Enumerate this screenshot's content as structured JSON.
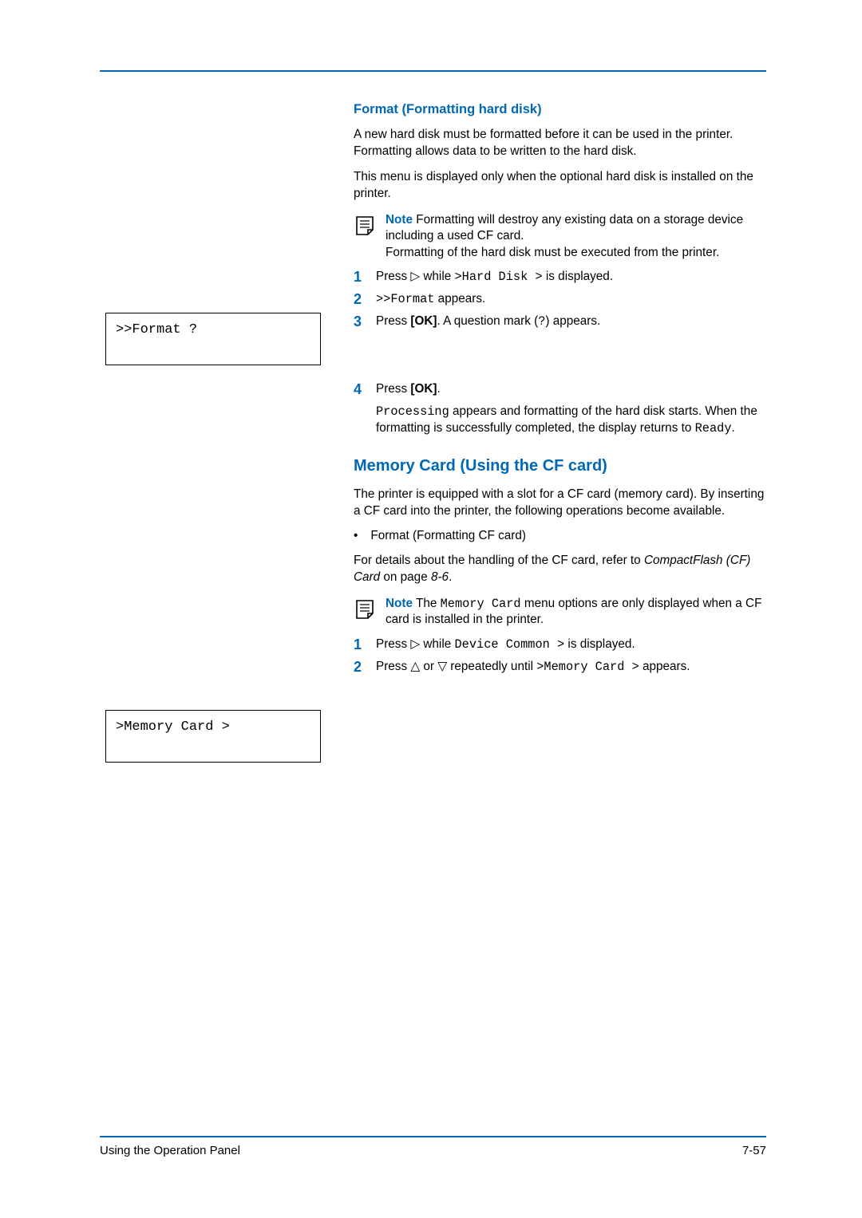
{
  "section1": {
    "heading": "Format (Formatting hard disk)",
    "p1": "A new hard disk must be formatted before it can be used in the printer. Formatting allows data to be written to the hard disk.",
    "p2": "This menu is displayed only when the optional hard disk is installed on the printer.",
    "note_label": "Note",
    "note_l1": "  Formatting will destroy any existing data on a storage device including a used CF card.",
    "note_l2": "Formatting of the hard disk must be executed from the printer.",
    "step1_a": "Press ",
    "step1_b": " while ",
    "step1_c": ">Hard Disk >",
    "step1_d": " is displayed.",
    "step2_a": ">>Format",
    "step2_b": " appears.",
    "step3_a": "Press ",
    "step3_b": "[OK]",
    "step3_c": ". A question mark (",
    "step3_d": "?",
    "step3_e": ") appears.",
    "step4_a": "Press ",
    "step4_b": "[OK]",
    "step4_c": ".",
    "step4_body_a": "Processing",
    "step4_body_b": " appears and formatting of the hard disk starts. When the formatting is successfully completed, the display returns to ",
    "step4_body_c": "Ready",
    "step4_body_d": "."
  },
  "display1": ">>Format ?",
  "section2": {
    "heading": "Memory Card (Using the CF card)",
    "p1": "The printer is equipped with a slot for a CF card (memory card). By inserting a CF card into the printer, the following operations become available.",
    "bullet1": "Format (Formatting CF card)",
    "p2_a": "For details about the handling of the CF card, refer to ",
    "p2_b": "CompactFlash (CF) Card",
    "p2_c": " on page ",
    "p2_d": "8-6",
    "p2_e": ".",
    "note_label": "Note",
    "note_a": "  The ",
    "note_b": "Memory Card",
    "note_c": " menu options are only displayed when a CF card is installed in the printer.",
    "step1_a": "Press ",
    "step1_b": " while ",
    "step1_c": "Device Common >",
    "step1_d": " is displayed.",
    "step2_a": "Press ",
    "step2_b": " or ",
    "step2_c": " repeatedly until ",
    "step2_d": ">Memory Card >",
    "step2_e": " appears."
  },
  "display2": ">Memory Card   >",
  "footer": {
    "left": "Using the Operation Panel",
    "right": "7-57"
  },
  "numbers": {
    "n1": "1",
    "n2": "2",
    "n3": "3",
    "n4": "4"
  },
  "glyphs": {
    "right": "▷",
    "up": "△",
    "down": "▽",
    "bullet": "•"
  }
}
